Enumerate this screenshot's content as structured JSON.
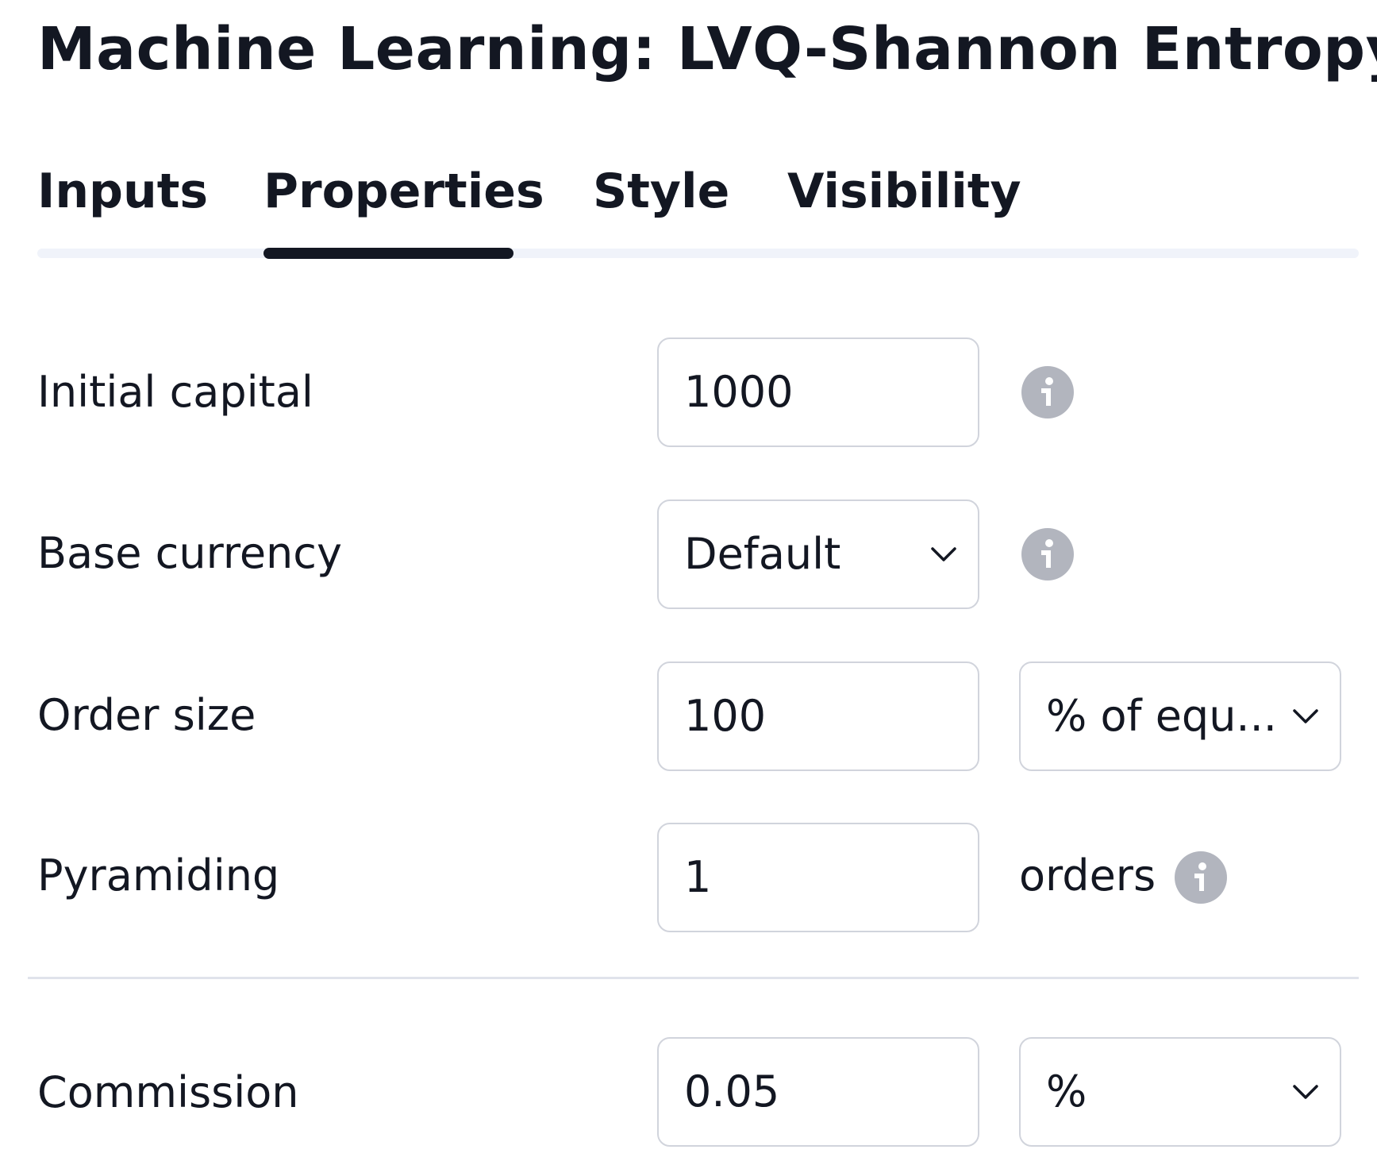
{
  "dialog": {
    "title": "Machine Learning: LVQ-Shannon Entropy"
  },
  "tabs": [
    {
      "label": "Inputs",
      "active": false
    },
    {
      "label": "Properties",
      "active": true
    },
    {
      "label": "Style",
      "active": false
    },
    {
      "label": "Visibility",
      "active": false
    }
  ],
  "properties": {
    "initial_capital": {
      "label": "Initial capital",
      "value": "1000",
      "info_icon": "info-icon"
    },
    "base_currency": {
      "label": "Base currency",
      "selected": "Default",
      "info_icon": "info-icon"
    },
    "order_size": {
      "label": "Order size",
      "value": "100",
      "unit_selected": "% of equ..."
    },
    "pyramiding": {
      "label": "Pyramiding",
      "value": "1",
      "suffix": "orders",
      "info_icon": "info-icon"
    },
    "commission": {
      "label": "Commission",
      "value": "0.05",
      "unit_selected": "%"
    }
  },
  "colors": {
    "text": "#131722",
    "active_tab_indicator": "#131722",
    "tab_track": "#f0f3fa",
    "field_border": "#d1d4dc",
    "info_icon": "#b2b5be",
    "divider": "#e0e3eb"
  }
}
